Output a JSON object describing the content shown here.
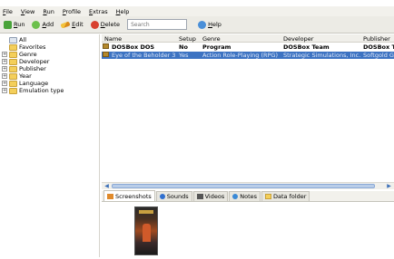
{
  "menu": [
    "File",
    "View",
    "Run",
    "Profile",
    "Extras",
    "Help"
  ],
  "toolbar": {
    "run": "Run",
    "add": "Add",
    "edit": "Edit",
    "delete": "Delete",
    "search_placeholder": "Search",
    "help": "Help"
  },
  "tree": {
    "items": [
      {
        "label": "All",
        "icon": "all-icon",
        "expandable": false
      },
      {
        "label": "Favorites",
        "icon": "folder-icon",
        "expandable": false
      },
      {
        "label": "Genre",
        "icon": "folder-icon",
        "expandable": true
      },
      {
        "label": "Developer",
        "icon": "folder-icon",
        "expandable": true
      },
      {
        "label": "Publisher",
        "icon": "folder-icon",
        "expandable": true
      },
      {
        "label": "Year",
        "icon": "folder-icon",
        "expandable": true
      },
      {
        "label": "Language",
        "icon": "folder-icon",
        "expandable": true
      },
      {
        "label": "Emulation type",
        "icon": "folder-icon",
        "expandable": true
      }
    ]
  },
  "grid": {
    "columns": [
      "Name",
      "Setup",
      "Genre",
      "Developer",
      "Publisher"
    ],
    "rows": [
      {
        "name": "DOSBox DOS",
        "setup": "No",
        "genre": "Program",
        "developer": "DOSBox Team",
        "publisher": "DOSBox Te"
      },
      {
        "name": "Eye of the Beholder 3",
        "setup": "Yes",
        "genre": "Action Role-Playing (RPG)",
        "developer": "Strategic Simulations, Inc.",
        "publisher": "Softgold G"
      }
    ],
    "selected_row": 1
  },
  "tabs": {
    "screenshots": "Screenshots",
    "sounds": "Sounds",
    "videos": "Videos",
    "notes": "Notes",
    "data_folder": "Data folder",
    "active": "screenshots"
  },
  "colors": {
    "selection": "#3d73c2",
    "toolbar_bg": "#ecebe5",
    "accent_green": "#49a33a",
    "accent_red": "#d8412f"
  }
}
